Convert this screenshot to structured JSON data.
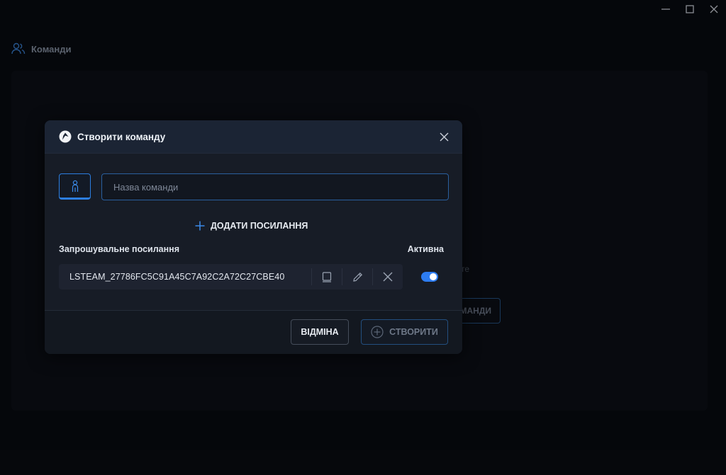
{
  "page": {
    "title": "Команди",
    "icon": "users-icon"
  },
  "background": {
    "hint_text": "те",
    "create_button_label": "МАНДИ"
  },
  "window_controls": [
    "minimize-icon",
    "maximize-icon",
    "close-icon"
  ],
  "modal": {
    "title": "Створити команду",
    "icon": "logo-icon",
    "name_input": {
      "placeholder": "Назва команди",
      "value": ""
    },
    "add_link_label": "ДОДАТИ ПОСИЛАННЯ",
    "invite_label": "Запрошувальне посилання",
    "active_label": "Активна",
    "invite": {
      "code": "LSTEAM_27786FC5C91A45C7A92C2A72C27CBE40",
      "active": true,
      "actions": [
        "copy-icon",
        "edit-icon",
        "delete-icon"
      ]
    },
    "cancel_label": "ВІДМІНА",
    "create_label": "СТВОРИТИ"
  },
  "colors": {
    "accent": "#2d7cf0",
    "background": "#090c12",
    "modal": "#171c26"
  }
}
